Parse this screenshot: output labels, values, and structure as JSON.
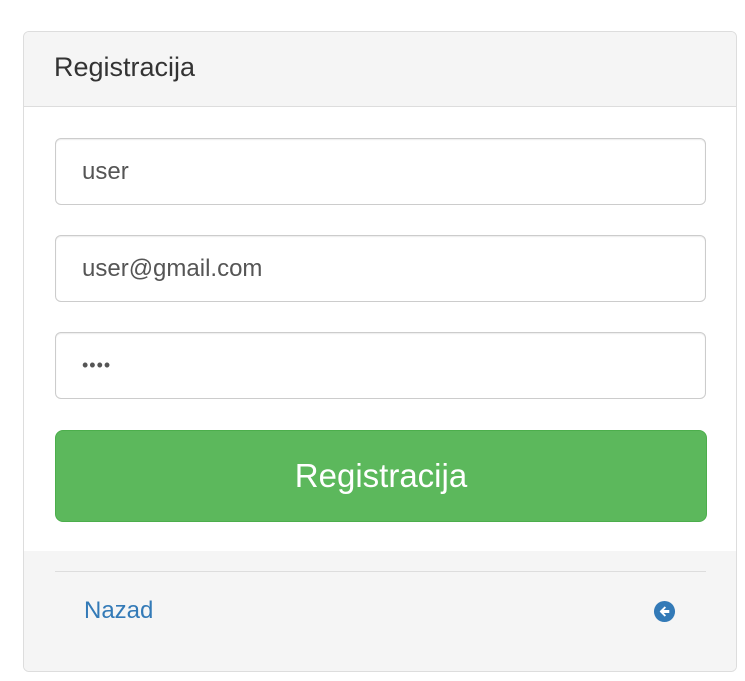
{
  "panel": {
    "title": "Registracija"
  },
  "form": {
    "username_value": "user",
    "email_value": "user@gmail.com",
    "password_value": "••••",
    "submit_label": "Registracija"
  },
  "footer": {
    "back_label": "Nazad",
    "back_icon": "circle-arrow-left-icon"
  },
  "colors": {
    "accent_green": "#5cb85c",
    "link_blue": "#337ab7",
    "panel_gray": "#f5f5f5"
  }
}
